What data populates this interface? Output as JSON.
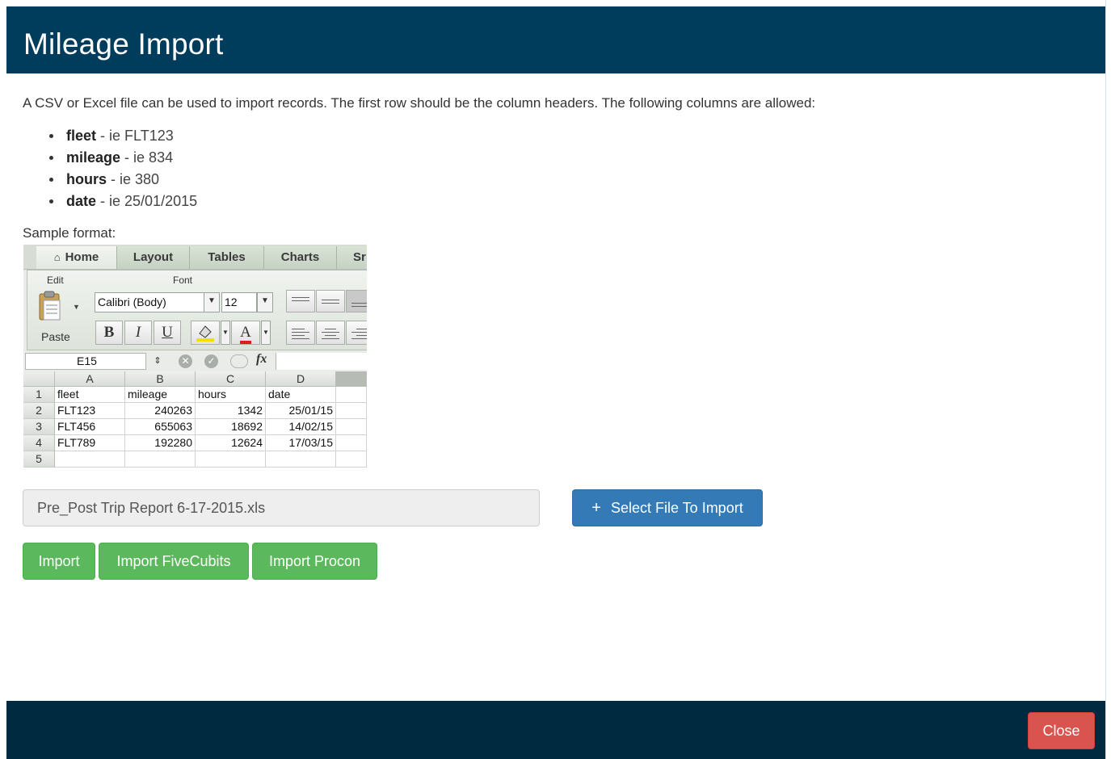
{
  "modal": {
    "title": "Mileage Import",
    "intro": "A CSV or Excel file can be used to import records. The first row should be the column headers. The following columns are allowed:",
    "columns": [
      {
        "name": "fleet",
        "example": " - ie FLT123"
      },
      {
        "name": "mileage",
        "example": " - ie 834"
      },
      {
        "name": "hours",
        "example": " - ie 380"
      },
      {
        "name": "date",
        "example": " - ie 25/01/2015"
      }
    ],
    "sample_label": "Sample format:"
  },
  "excel": {
    "tabs": [
      "Home",
      "Layout",
      "Tables",
      "Charts",
      "Sr"
    ],
    "groups": {
      "edit": "Edit",
      "font": "Font"
    },
    "paste_label": "Paste",
    "font_name": "Calibri (Body)",
    "font_size": "12",
    "bold": "B",
    "italic": "I",
    "underline": "U",
    "font_color_letter": "A",
    "cell_ref": "E15",
    "fx": "fx",
    "col_headers": [
      "A",
      "B",
      "C",
      "D"
    ],
    "rows": [
      {
        "n": "1",
        "cells": [
          "fleet",
          "mileage",
          "hours",
          "date"
        ]
      },
      {
        "n": "2",
        "cells": [
          "FLT123",
          "240263",
          "1342",
          "25/01/15"
        ]
      },
      {
        "n": "3",
        "cells": [
          "FLT456",
          "655063",
          "18692",
          "14/02/15"
        ]
      },
      {
        "n": "4",
        "cells": [
          "FLT789",
          "192280",
          "12624",
          "17/03/15"
        ]
      },
      {
        "n": "5",
        "cells": [
          "",
          "",
          "",
          ""
        ]
      }
    ]
  },
  "file": {
    "selected_name": "Pre_Post Trip Report 6-17-2015.xls",
    "select_label": "Select File To Import",
    "select_icon": "+"
  },
  "actions": {
    "import": "Import",
    "import_fivecubits": "Import FiveCubits",
    "import_procon": "Import Procon"
  },
  "footer": {
    "close": "Close"
  },
  "colors": {
    "header": "#003d5c",
    "footer": "#002a40",
    "primary": "#337ab7",
    "success": "#5cb85c",
    "danger": "#d9534f"
  }
}
